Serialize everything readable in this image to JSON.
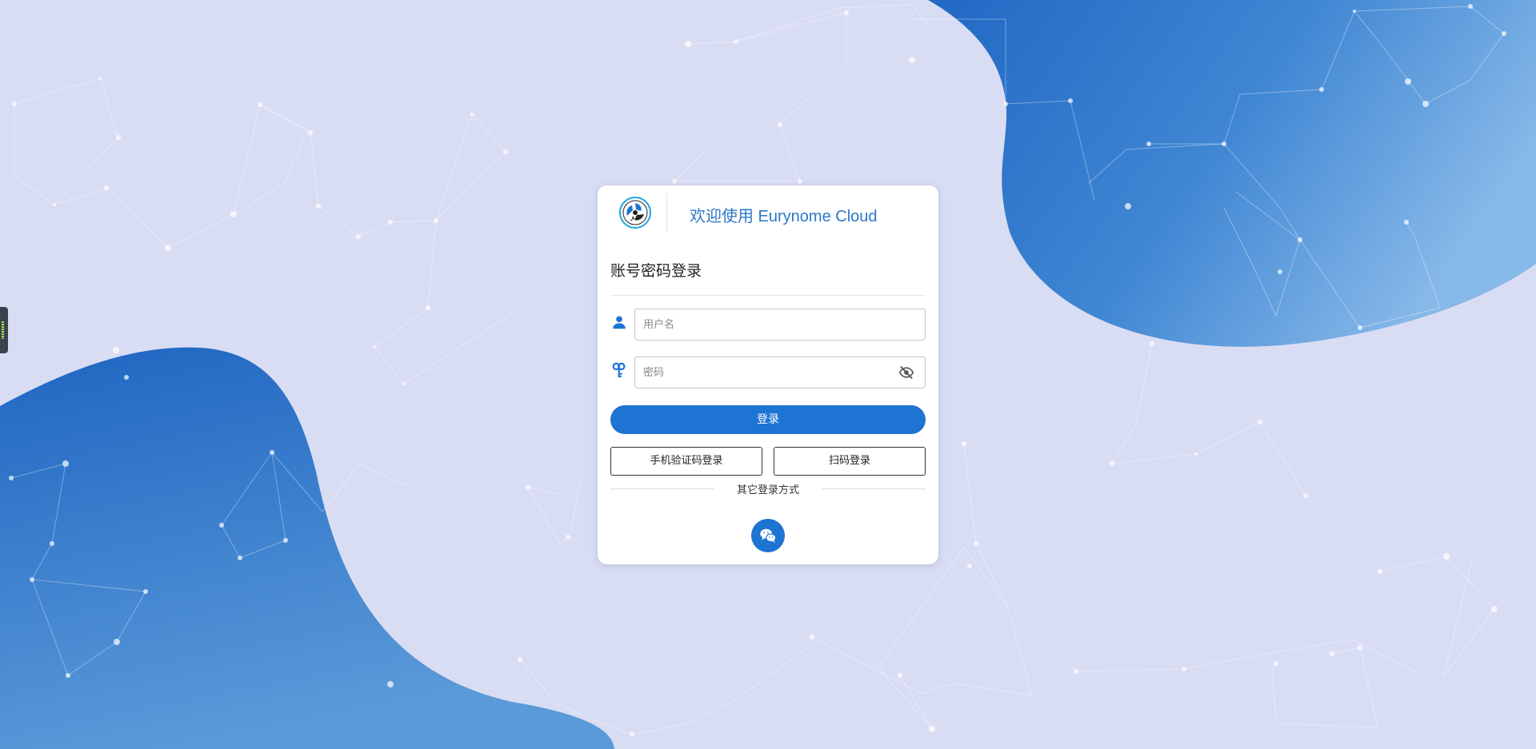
{
  "header": {
    "welcome_text": "欢迎使用 Eurynome Cloud"
  },
  "login": {
    "title": "账号密码登录",
    "username_placeholder": "用户名",
    "password_placeholder": "密码",
    "submit_label": "登录"
  },
  "alt_login": {
    "sms_label": "手机验证码登录",
    "qr_label": "扫码登录",
    "other_methods_label": "其它登录方式"
  },
  "icons": {
    "logo": "eurynome-logo-icon",
    "user": "user-icon",
    "password": "key-icon",
    "visibility": "eye-off-icon",
    "wechat": "wechat-icon"
  },
  "colors": {
    "primary": "#1d74d2",
    "page_background": "#d9ddf4",
    "welcome_text": "#2d77c9"
  }
}
